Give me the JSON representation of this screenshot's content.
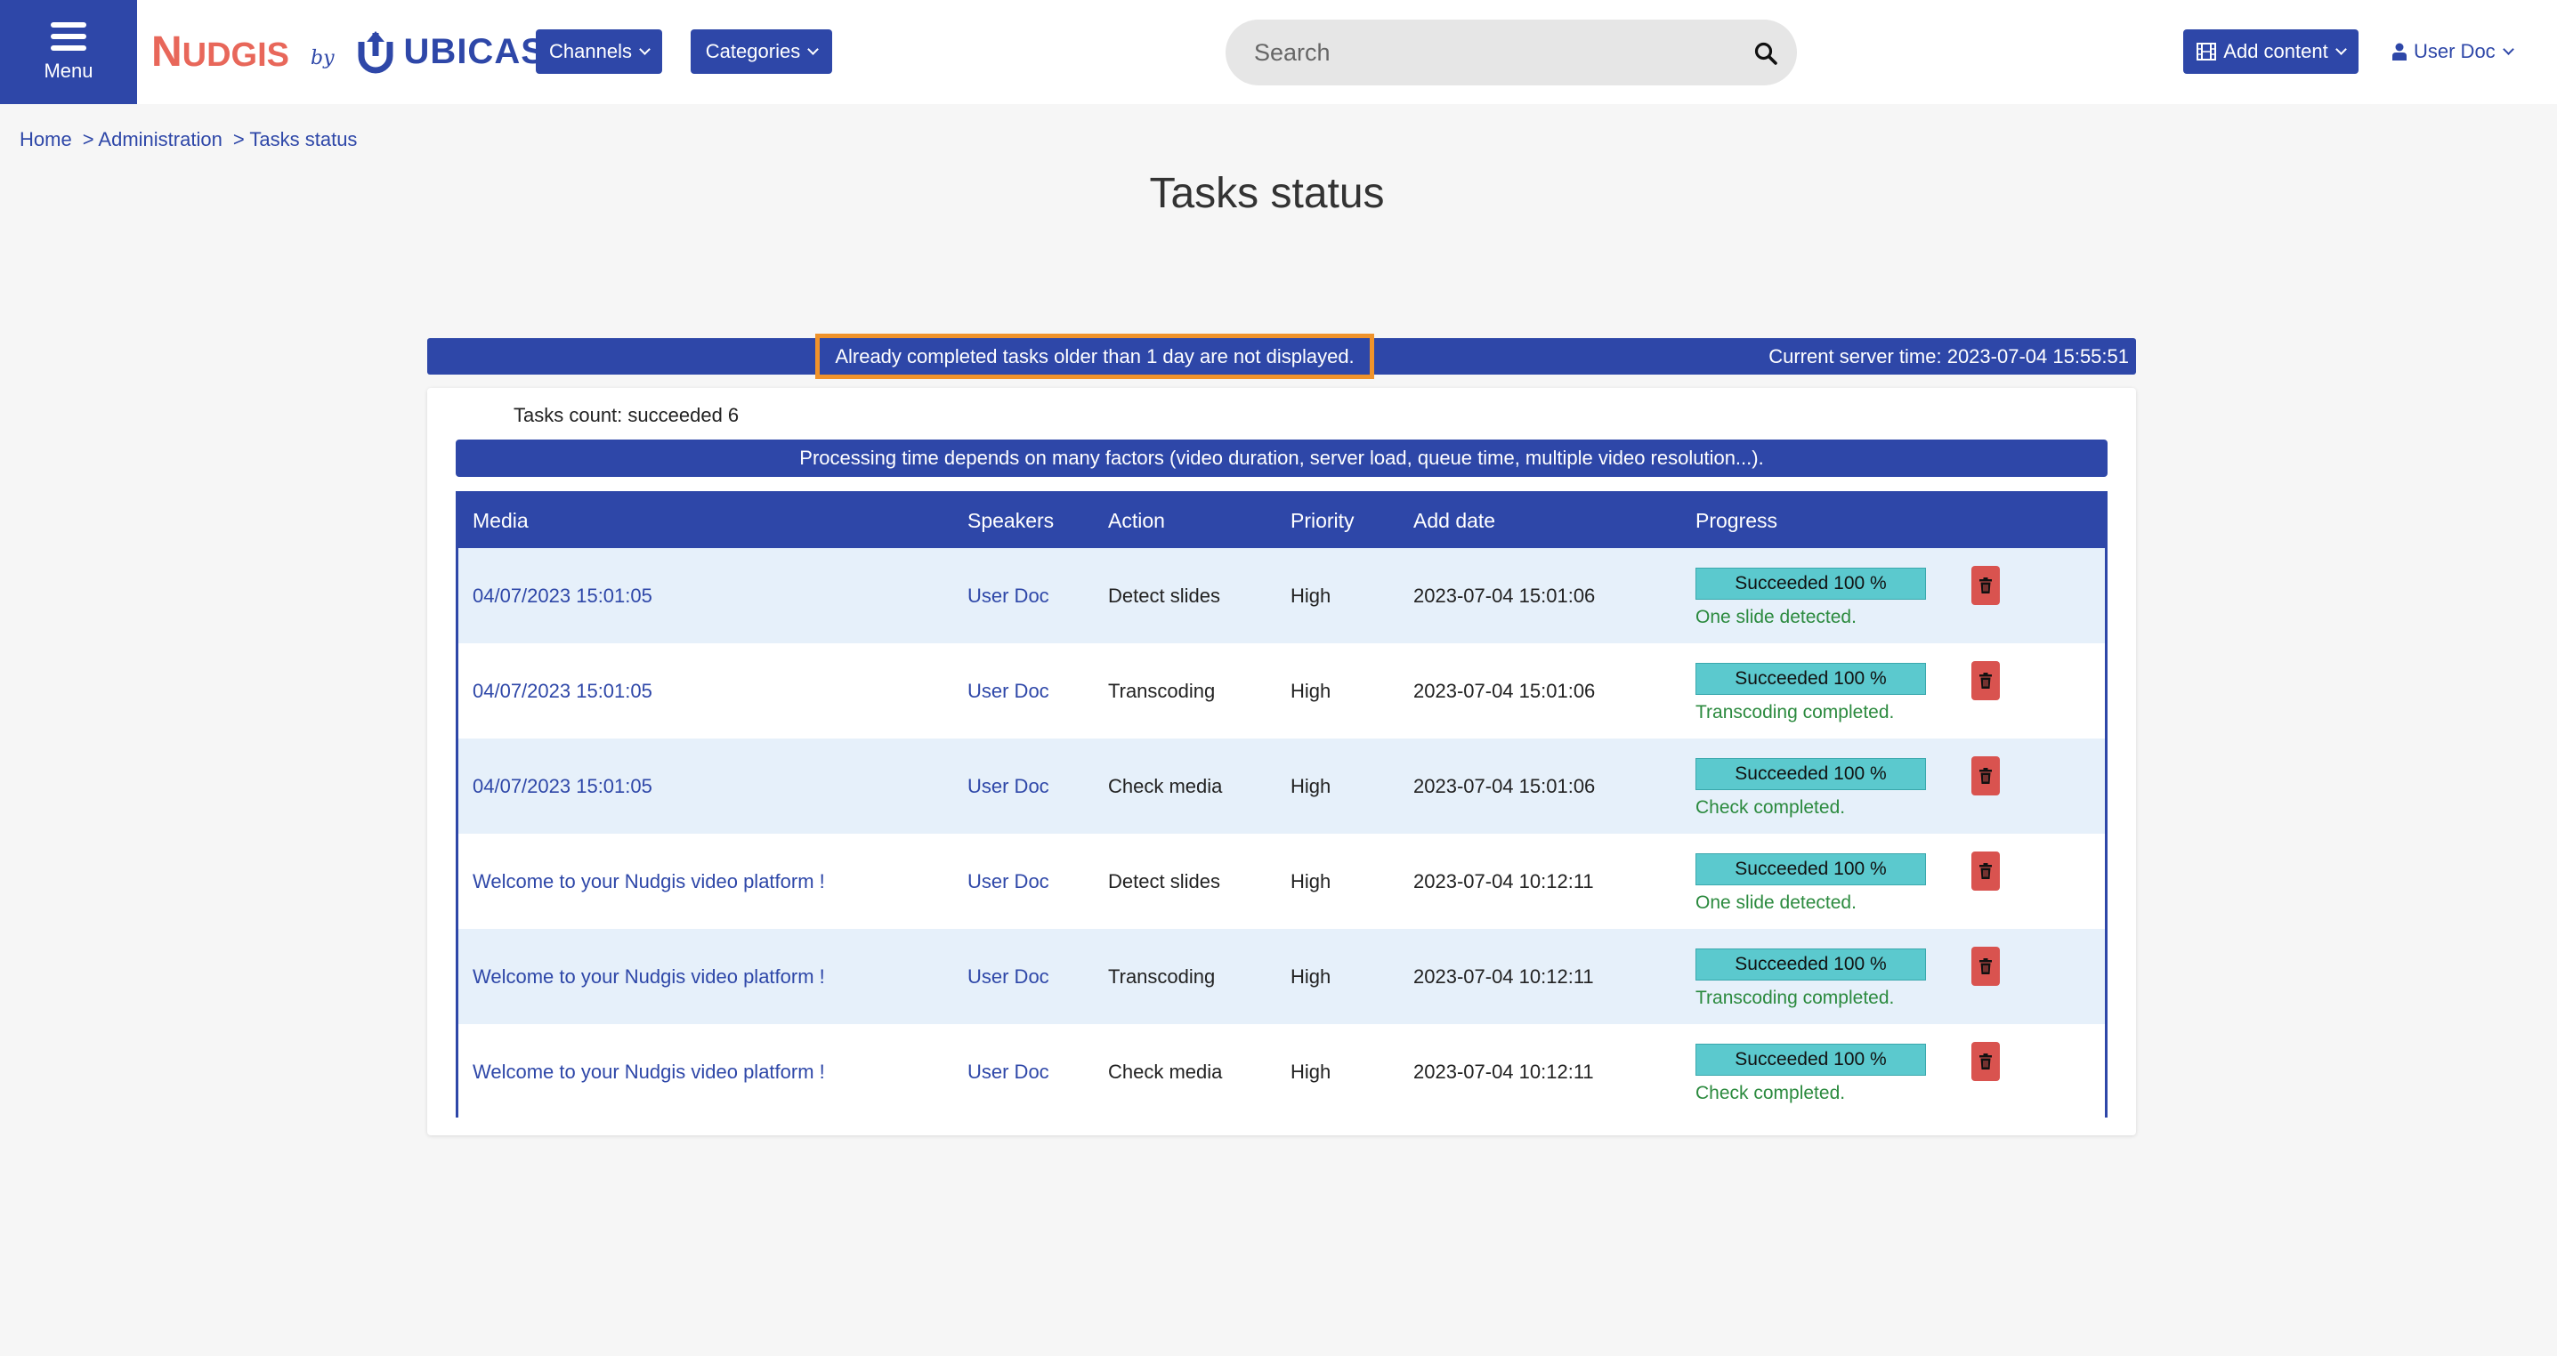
{
  "header": {
    "menu_label": "Menu",
    "logo_nudgis_first": "N",
    "logo_nudgis_rest": "UDGIS",
    "logo_by": "by",
    "logo_ubicast": "UBICAST",
    "channels_label": "Channels",
    "categories_label": "Categories",
    "search_placeholder": "Search",
    "add_content_label": "Add content",
    "user_label": "User Doc"
  },
  "breadcrumb": {
    "home": "Home",
    "admin": "> Administration",
    "current": "> Tasks status"
  },
  "page_title": "Tasks status",
  "info_bar": {
    "notice": "Already completed tasks older than 1 day are not displayed.",
    "server_time": "Current server time: 2023-07-04 15:55:51"
  },
  "tasks_count": "Tasks count: succeeded 6",
  "processing_note": "Processing time depends on many factors (video duration, server load, queue time, multiple video resolution...).",
  "table": {
    "headers": {
      "media": "Media",
      "speakers": "Speakers",
      "action": "Action",
      "priority": "Priority",
      "add_date": "Add date",
      "progress": "Progress"
    },
    "rows": [
      {
        "media": "04/07/2023 15:01:05",
        "speaker": "User Doc",
        "action": "Detect slides",
        "priority": "High",
        "add_date": "2023-07-04 15:01:06",
        "progress": "Succeeded 100 %",
        "message": "One slide detected."
      },
      {
        "media": "04/07/2023 15:01:05",
        "speaker": "User Doc",
        "action": "Transcoding",
        "priority": "High",
        "add_date": "2023-07-04 15:01:06",
        "progress": "Succeeded 100 %",
        "message": "Transcoding completed."
      },
      {
        "media": "04/07/2023 15:01:05",
        "speaker": "User Doc",
        "action": "Check media",
        "priority": "High",
        "add_date": "2023-07-04 15:01:06",
        "progress": "Succeeded 100 %",
        "message": "Check completed."
      },
      {
        "media": "Welcome to your Nudgis video platform !",
        "speaker": "User Doc",
        "action": "Detect slides",
        "priority": "High",
        "add_date": "2023-07-04 10:12:11",
        "progress": "Succeeded 100 %",
        "message": "One slide detected."
      },
      {
        "media": "Welcome to your Nudgis video platform !",
        "speaker": "User Doc",
        "action": "Transcoding",
        "priority": "High",
        "add_date": "2023-07-04 10:12:11",
        "progress": "Succeeded 100 %",
        "message": "Transcoding completed."
      },
      {
        "media": "Welcome to your Nudgis video platform !",
        "speaker": "User Doc",
        "action": "Check media",
        "priority": "High",
        "add_date": "2023-07-04 10:12:11",
        "progress": "Succeeded 100 %",
        "message": "Check completed."
      }
    ]
  },
  "colors": {
    "brand_blue": "#2e47a8",
    "nudgis_coral": "#e8675a",
    "progress_teal": "#5bc9ce",
    "success_green": "#2b8a3e",
    "delete_red": "#d9534f",
    "highlight_orange": "#f0932b"
  },
  "icons": {
    "menu": "hamburger-icon",
    "search": "search-icon",
    "add_content": "film-icon",
    "user": "user-icon",
    "delete": "trash-icon"
  }
}
